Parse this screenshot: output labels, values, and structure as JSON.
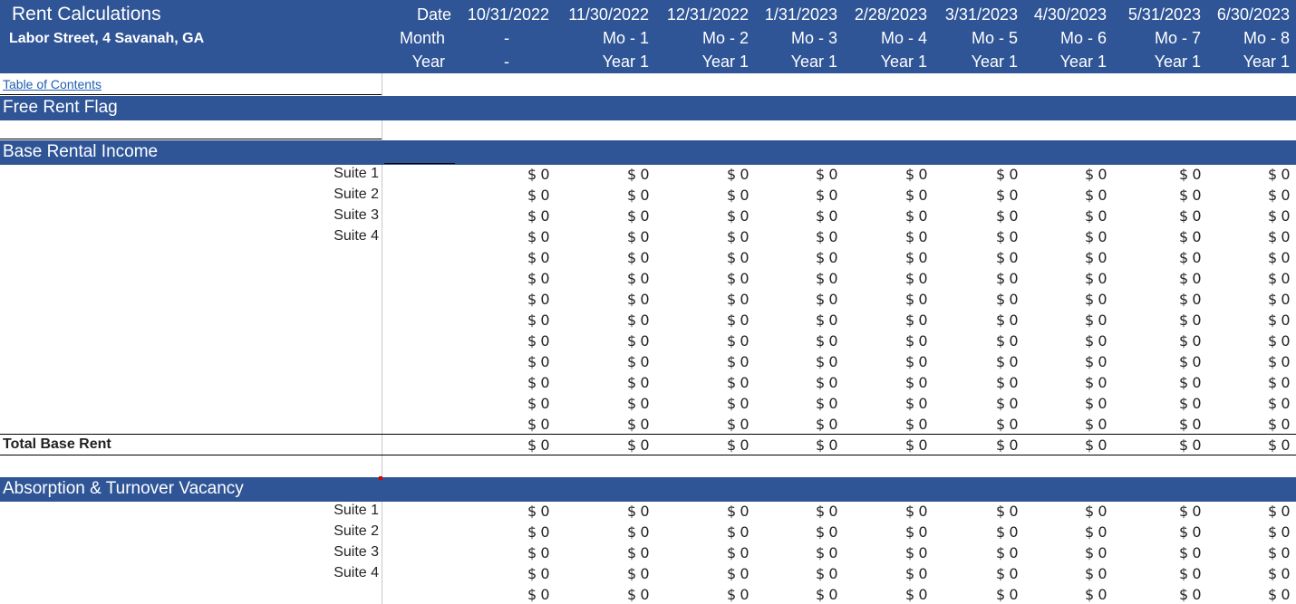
{
  "sheet": {
    "title": "Rent Calculations",
    "address": "Labor Street, 4 Savanah, GA",
    "toc_link": "Table of Contents"
  },
  "header_labels": {
    "date": "Date",
    "month": "Month",
    "year": "Year"
  },
  "columns": [
    {
      "date": "10/31/2022",
      "month": "-",
      "year": "-"
    },
    {
      "date": "11/30/2022",
      "month": "Mo - 1",
      "year": "Year 1"
    },
    {
      "date": "12/31/2022",
      "month": "Mo - 2",
      "year": "Year 1"
    },
    {
      "date": "1/31/2023",
      "month": "Mo - 3",
      "year": "Year 1"
    },
    {
      "date": "2/28/2023",
      "month": "Mo - 4",
      "year": "Year 1"
    },
    {
      "date": "3/31/2023",
      "month": "Mo - 5",
      "year": "Year 1"
    },
    {
      "date": "4/30/2023",
      "month": "Mo - 6",
      "year": "Year 1"
    },
    {
      "date": "5/31/2023",
      "month": "Mo - 7",
      "year": "Year 1"
    },
    {
      "date": "6/30/2023",
      "month": "Mo - 8",
      "year": "Year 1"
    }
  ],
  "sections": {
    "free_rent_flag": "Free Rent Flag",
    "base_rental_income": "Base Rental Income",
    "total_base_rent": "Total Base Rent",
    "absorption_turnover": "Absorption & Turnover Vacancy"
  },
  "base_rows": [
    "Suite 1",
    "Suite 2",
    "Suite 3",
    "Suite 4",
    "",
    "",
    "",
    "",
    "",
    "",
    "",
    "",
    ""
  ],
  "absorption_rows": [
    "Suite 1",
    "Suite 2",
    "Suite 3",
    "Suite 4",
    ""
  ],
  "cell_value": "$ 0",
  "colors": {
    "header_blue": "#2F5597",
    "link_blue": "#1f5fb0"
  }
}
